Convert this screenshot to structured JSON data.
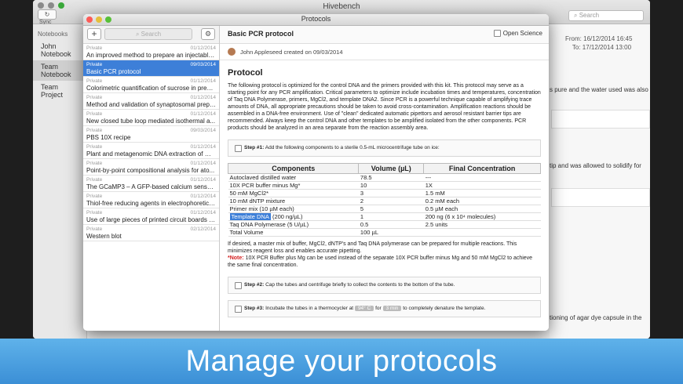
{
  "main_window": {
    "title": "Hivebench",
    "sync_label": "Sync",
    "search_placeholder": "Search",
    "sidebar_header": "Notebooks",
    "sidebar_items": [
      "John Notebook",
      "Team Notebook",
      "Team Project"
    ],
    "from_label": "From:",
    "from_value": "16/12/2014 16:45",
    "to_label": "To:",
    "to_value": "17/12/2014 13:00",
    "behind_notes": [
      "s pure and the water used was also",
      "tip and was allowed to solidify for",
      "tioning of agar dye capsule in the"
    ]
  },
  "protocols_window": {
    "title": "Protocols",
    "search_placeholder": "Search",
    "list": [
      {
        "privacy": "Private",
        "date": "01/12/2014",
        "title": "An improved method to prepare an injectable..."
      },
      {
        "privacy": "Private",
        "date": "09/03/2014",
        "title": "Basic PCR protocol"
      },
      {
        "privacy": "Private",
        "date": "01/12/2014",
        "title": "Colorimetric quantification of sucrose in prese..."
      },
      {
        "privacy": "Private",
        "date": "01/12/2014",
        "title": "Method and validation of synaptosomal prepa..."
      },
      {
        "privacy": "Private",
        "date": "01/12/2014",
        "title": "New closed tube loop mediated isothermal a..."
      },
      {
        "privacy": "Private",
        "date": "09/03/2014",
        "title": "PBS 10X recipe"
      },
      {
        "privacy": "Private",
        "date": "01/12/2014",
        "title": "Plant and metagenomic DNA extraction of mu..."
      },
      {
        "privacy": "Private",
        "date": "01/12/2014",
        "title": "Point-by-point compositional analysis for ato..."
      },
      {
        "privacy": "Private",
        "date": "01/12/2014",
        "title": "The GCaMP3 – A GFP-based calcium sensor f..."
      },
      {
        "privacy": "Private",
        "date": "01/12/2014",
        "title": "Thiol-free reducing agents in electrophoretic s..."
      },
      {
        "privacy": "Private",
        "date": "01/12/2014",
        "title": "Use of large pieces of printed circuit boards fo..."
      },
      {
        "privacy": "Private",
        "date": "02/12/2014",
        "title": "Western blot"
      }
    ],
    "selected_index": 1,
    "detail": {
      "title": "Basic PCR protocol",
      "open_science": "Open Science",
      "author_line": "John Appleseed created on 09/03/2014",
      "heading": "Protocol",
      "intro": "The following protocol is optimized for the control DNA and the primers provided with this kit. This protocol may serve as a starting point for any PCR amplification. Critical parameters to optimize include incubation times and temperatures, concentration of Taq DNA Polymerase, primers, MgCl2, and template DNA2. Since PCR is a powerful technique capable of amplifying trace amounts of DNA, all appropriate precautions should be taken to avoid cross-contamination. Amplification reactions should be assembled in a DNA-free environment. Use of \"clean\" dedicated automatic pipettors and aerosol resistant barrier tips are recommended. Always keep the control DNA and other templates to be amplified isolated from the other components. PCR products should be analyzed in an area separate from the reaction assembly area.",
      "step1": {
        "label": "Step #1:",
        "text": "Add the following components to a sterile 0.5-mL microcentrifuge tube on ice:"
      },
      "table_headers": [
        "Components",
        "Volume (µL)",
        "Final Concentration"
      ],
      "table_rows": [
        [
          "Autoclaved distilled water",
          "78.5",
          "---"
        ],
        [
          "10X PCR buffer minus Mg*",
          "10",
          "1X"
        ],
        [
          "50 mM MgCl2*",
          "3",
          "1.5 mM"
        ],
        [
          "10 mM dNTP mixture",
          "2",
          "0.2 mM each"
        ],
        [
          "Primer mix (10 µM each)",
          "5",
          "0.5 µM each"
        ],
        [
          "Template DNA",
          "1",
          "200 ng (6 x 10⁴ molecules)"
        ],
        [
          "Taq DNA Polymerase (5 U/µL)",
          "0.5",
          "2.5 units"
        ],
        [
          "Total Volume",
          "100 µL",
          ""
        ]
      ],
      "template_suffix": "(200 ng/µL)",
      "note1": "If desired, a master mix of buffer, MgCl2, dNTP's and Taq DNA polymerase can be prepared for multiple reactions. This minimizes reagent loss and enables accurate pipetting.",
      "note_label": "*Note:",
      "note2": "10X PCR Buffer plus Mg can be used instead of the separate 10X PCR buffer minus Mg and 50 mM MgCl2 to achieve the same final concentration.",
      "step2": {
        "label": "Step #2:",
        "text": "Cap the tubes and centrifuge briefly to collect the contents to the bottom of the tube."
      },
      "step3": {
        "label": "Step #3:",
        "text_a": "Incubate the tubes in a thermocycler at",
        "temp": "94° C",
        "for_word": "for",
        "duration": "3 min",
        "text_b": "to completely denature the template."
      }
    }
  },
  "banner": {
    "text": "Manage your protocols",
    "color": "#4aa2e2"
  },
  "colors": {
    "selection": "#3d7fd8",
    "note_red": "#d42020"
  }
}
